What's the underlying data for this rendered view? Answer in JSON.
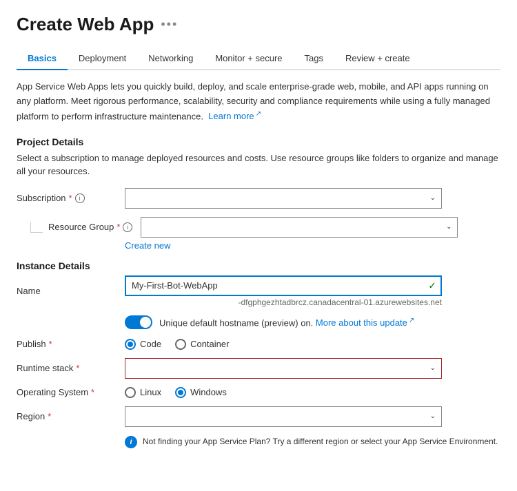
{
  "header": {
    "title": "Create Web App",
    "more_icon": "•••"
  },
  "tabs": [
    {
      "label": "Basics",
      "active": true
    },
    {
      "label": "Deployment",
      "active": false
    },
    {
      "label": "Networking",
      "active": false
    },
    {
      "label": "Monitor + secure",
      "active": false
    },
    {
      "label": "Tags",
      "active": false
    },
    {
      "label": "Review + create",
      "active": false
    }
  ],
  "description": {
    "text": "App Service Web Apps lets you quickly build, deploy, and scale enterprise-grade web, mobile, and API apps running on any platform. Meet rigorous performance, scalability, security and compliance requirements while using a fully managed platform to perform infrastructure maintenance.",
    "learn_more_label": "Learn more",
    "external_icon": "↗"
  },
  "project_details": {
    "heading": "Project Details",
    "description": "Select a subscription to manage deployed resources and costs. Use resource groups like folders to organize and manage all your resources.",
    "subscription": {
      "label": "Subscription",
      "required": "*",
      "info": "i",
      "placeholder": "",
      "arrow": "⌄"
    },
    "resource_group": {
      "label": "Resource Group",
      "required": "*",
      "info": "i",
      "placeholder": "",
      "arrow": "⌄"
    },
    "create_new": "Create new"
  },
  "instance_details": {
    "heading": "Instance Details",
    "name": {
      "label": "Name",
      "value": "My-First-Bot-WebApp",
      "check": "✓",
      "domain_suffix": "-dfgphgezhtadbrcz.canadacentral-01.azurewebsites.net"
    },
    "hostname": {
      "toggle_state": "on",
      "label_text": "Unique default hostname (preview) on.",
      "more_label": "More about this update",
      "external_icon": "↗"
    },
    "publish": {
      "label": "Publish",
      "required": "*",
      "options": [
        {
          "label": "Code",
          "checked": true
        },
        {
          "label": "Container",
          "checked": false
        }
      ]
    },
    "runtime_stack": {
      "label": "Runtime stack",
      "required": "*",
      "value": "",
      "arrow": "⌄"
    },
    "operating_system": {
      "label": "Operating System",
      "required": "*",
      "options": [
        {
          "label": "Linux",
          "checked": false
        },
        {
          "label": "Windows",
          "checked": true
        }
      ]
    },
    "region": {
      "label": "Region",
      "required": "*",
      "value": "",
      "arrow": "⌄"
    },
    "info_note": {
      "icon": "i",
      "text": "Not finding your App Service Plan? Try a different region or select your App Service Environment."
    }
  }
}
